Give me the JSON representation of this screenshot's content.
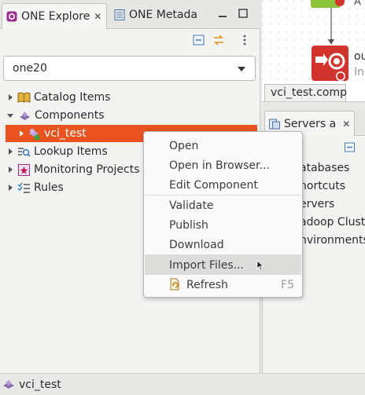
{
  "left_view": {
    "tabs": [
      {
        "label": "ONE Explore"
      },
      {
        "label": "ONE Metada"
      }
    ],
    "combo": {
      "value": "one20"
    },
    "tree": [
      {
        "label": "Catalog Items",
        "expanded": false
      },
      {
        "label": "Components",
        "expanded": true
      },
      {
        "label": "vci_test",
        "selected": true
      },
      {
        "label": "Lookup Items",
        "expanded": false
      },
      {
        "label": "Monitoring Projects",
        "expanded": false
      },
      {
        "label": "Rules",
        "expanded": false
      }
    ]
  },
  "editor": {
    "tab_label": "vci_test.comp",
    "node_label_fragment_1": "ou",
    "node_label_fragment_2": "In",
    "node_label_fragment_top": "A"
  },
  "servers_view": {
    "tab_label": "Servers a",
    "items": [
      "atabases",
      "hortcuts",
      "ervers",
      "adoop Clust",
      "nvironments"
    ]
  },
  "context_menu": {
    "items": [
      {
        "label": "Open"
      },
      {
        "label": "Open in Browser..."
      },
      {
        "label": "Edit Component"
      },
      {
        "label": "Validate"
      },
      {
        "label": "Publish"
      },
      {
        "label": "Download"
      },
      {
        "label": "Import Files...",
        "hovered": true
      },
      {
        "label": "Refresh",
        "shortcut": "F5"
      }
    ]
  },
  "status_bar": {
    "text": "vci_test"
  },
  "colors": {
    "selection": "#e95420",
    "error_red": "#d0342c",
    "component_purple": "#8b6fb0"
  }
}
